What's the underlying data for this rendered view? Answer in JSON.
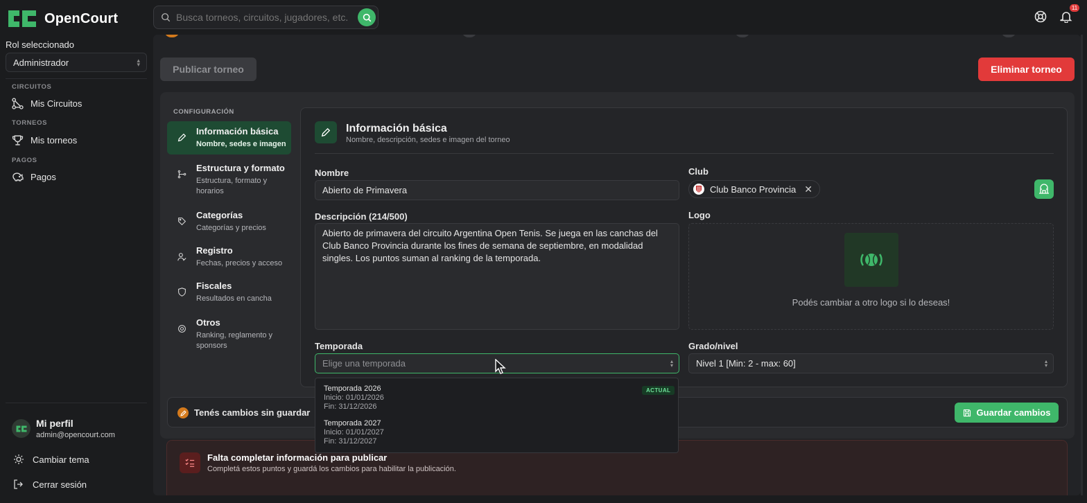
{
  "app": {
    "name": "OpenCourt"
  },
  "search": {
    "placeholder": "Busca torneos, circuitos, jugadores, etc."
  },
  "notifications": {
    "count": "11"
  },
  "sidebar": {
    "role_label": "Rol seleccionado",
    "role_value": "Administrador",
    "sections": [
      {
        "title": "CIRCUITOS",
        "item": "Mis Circuitos"
      },
      {
        "title": "TORNEOS",
        "item": "Mis torneos"
      },
      {
        "title": "PAGOS",
        "item": "Pagos"
      }
    ],
    "profile": {
      "name": "Mi perfil",
      "email": "admin@opencourt.com"
    },
    "theme_label": "Cambiar tema",
    "logout_label": "Cerrar sesión"
  },
  "actions": {
    "publish": "Publicar torneo",
    "delete": "Eliminar torneo"
  },
  "config": {
    "title": "CONFIGURACIÓN",
    "steps": [
      {
        "title": "Información básica",
        "sub": "Nombre, sedes e imagen"
      },
      {
        "title": "Estructura y formato",
        "sub": "Estructura, formato y horarios"
      },
      {
        "title": "Categorías",
        "sub": "Categorías y precios"
      },
      {
        "title": "Registro",
        "sub": "Fechas, precios y acceso"
      },
      {
        "title": "Fiscales",
        "sub": "Resultados en cancha"
      },
      {
        "title": "Otros",
        "sub": "Ranking, reglamento y sponsors"
      }
    ]
  },
  "form": {
    "title": "Información básica",
    "subtitle": "Nombre, descripción, sedes e imagen del torneo",
    "name_label": "Nombre",
    "name_value": "Abierto de Primavera",
    "club_label": "Club",
    "club_value": "Club Banco Provincia",
    "description_label": "Descripción (214/500)",
    "description_value": "Abierto de primavera del circuito Argentina Open Tenis. Se juega en las canchas del Club Banco Provincia durante los fines de semana de septiembre, en modalidad singles. Los puntos suman al ranking de la temporada.",
    "logo_label": "Logo",
    "logo_hint": "Podés cambiar a otro logo si lo deseas!",
    "season_label": "Temporada",
    "season_placeholder": "Elige una temporada",
    "level_label": "Grado/nivel",
    "level_value": "Nivel 1 [Min: 2 - max: 60]"
  },
  "season_options": [
    {
      "title": "Temporada 2026",
      "start": "Inicio: 01/01/2026",
      "end": "Fin: 31/12/2026",
      "badge": "ACTUAL"
    },
    {
      "title": "Temporada 2027",
      "start": "Inicio: 01/01/2027",
      "end": "Fin: 31/12/2027"
    }
  ],
  "unsaved": {
    "text": "Tenés cambios sin guardar",
    "save": "Guardar cambios"
  },
  "warning": {
    "title": "Falta completar información para publicar",
    "subtitle": "Completá estos puntos y guardá los cambios para habilitar la publicación."
  },
  "colors": {
    "accent": "#3fb76a",
    "danger": "#e23a3a",
    "active_step": "#1e4b33"
  }
}
